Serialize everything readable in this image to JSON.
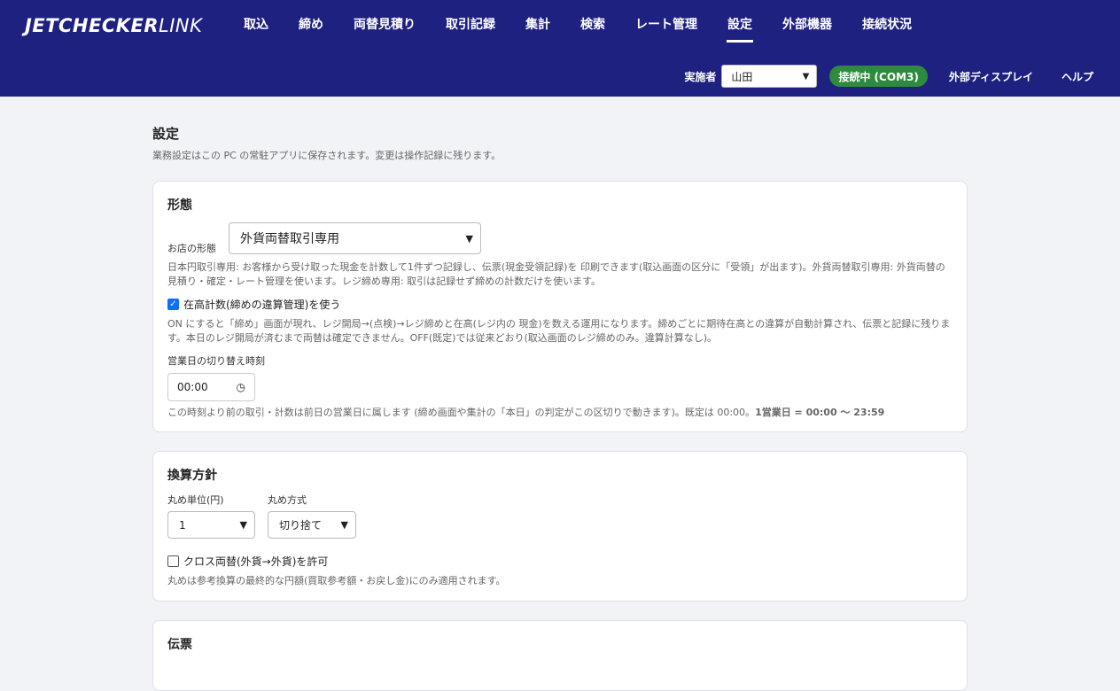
{
  "brand": {
    "bold": "JETCHECKER",
    "light": "LINK"
  },
  "nav": [
    "取込",
    "締め",
    "両替見積り",
    "取引記録",
    "集計",
    "検索",
    "レート管理",
    "設定",
    "外部機器",
    "接続状況"
  ],
  "header": {
    "operator_label": "実施者",
    "operator_value": "山田",
    "connection": "接続中 (COM3)",
    "external_display": "外部ディスプレイ",
    "help": "ヘルプ"
  },
  "page": {
    "title": "設定",
    "subtitle": "業務設定はこの PC の常駐アプリに保存されます。変更は操作記録に残ります。"
  },
  "form_card": {
    "title": "形態",
    "store_type_label": "お店の形態",
    "store_type_value": "外貨両替取引専用",
    "store_type_note": "日本円取引専用: お客様から受け取った現金を計数して1件ずつ記録し、伝票(現金受領記録)を 印刷できます(取込画面の区分に「受領」が出ます)。外貨両替取引専用: 外貨両替の見積り・確定・レート管理を使います。レジ締め専用: 取引は記録せず締めの計数だけを使います。",
    "stock_count_label": "在高計数(締めの違算管理)を使う",
    "stock_count_checked": true,
    "stock_count_note": "ON にすると「締め」画面が現れ、レジ開局→(点検)→レジ締めと在高(レジ内の 現金)を数える運用になります。締めごとに期待在高との違算が自動計算され、伝票と記録に残ります。本日のレジ開局が済むまで両替は確定できません。OFF(既定)では従来どおり(取込画面のレジ締めのみ。違算計算なし)。",
    "cutover_label": "営業日の切り替え時刻",
    "cutover_value": "00:00",
    "cutover_note": "この時刻より前の取引・計数は前日の営業日に属します (締め画面や集計の「本日」の判定がこの区切りで動きます)。既定は 00:00。",
    "cutover_note_bold": "1営業日 = 00:00 〜 23:59"
  },
  "rounding_card": {
    "title": "換算方針",
    "unit_label": "丸め単位(円)",
    "unit_value": "1",
    "method_label": "丸め方式",
    "method_value": "切り捨て",
    "cross_label": "クロス両替(外貨→外貨)を許可",
    "cross_checked": false,
    "note": "丸めは参考換算の最終的な円額(買取参考額・お戻し金)にのみ適用されます。"
  },
  "voucher_card": {
    "title": "伝票"
  }
}
